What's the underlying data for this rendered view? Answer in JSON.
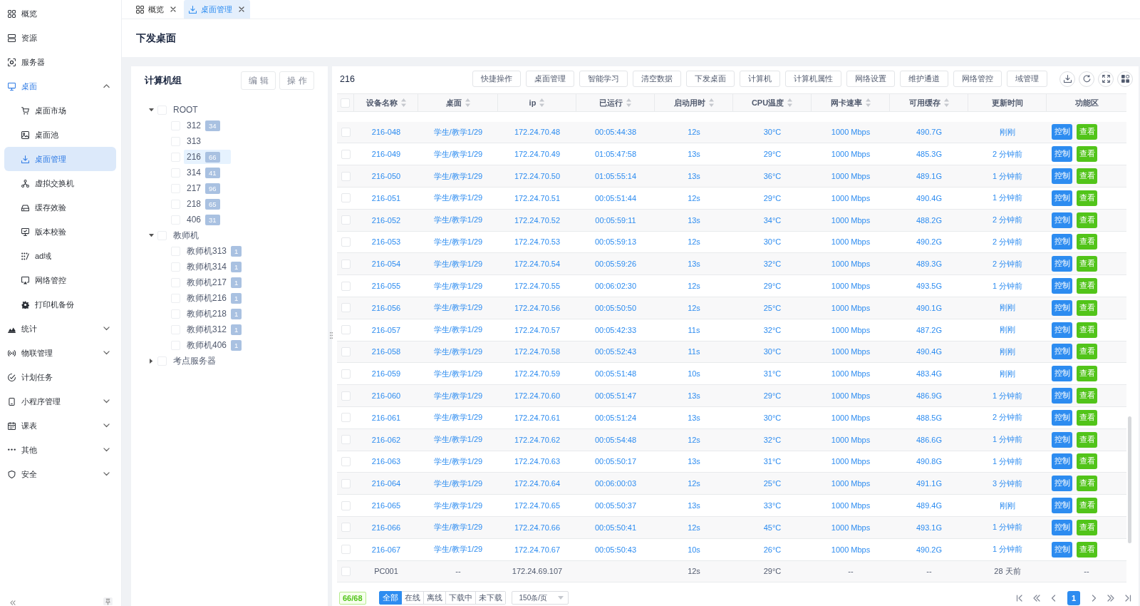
{
  "sidebar": {
    "items": [
      {
        "label": "概览",
        "selected": false
      },
      {
        "label": "资源",
        "selected": false
      },
      {
        "label": "服务器",
        "selected": false
      },
      {
        "label": "桌面",
        "selected": false,
        "expanded": true,
        "children": [
          {
            "label": "桌面市场",
            "selected": false
          },
          {
            "label": "桌面池",
            "selected": false
          },
          {
            "label": "桌面管理",
            "selected": true
          },
          {
            "label": "虚拟交换机",
            "selected": false
          },
          {
            "label": "缓存效验",
            "selected": false
          },
          {
            "label": "版本校验",
            "selected": false
          },
          {
            "label": "ad域",
            "selected": false
          },
          {
            "label": "网络管控",
            "selected": false
          },
          {
            "label": "打印机备份",
            "selected": false
          }
        ]
      },
      {
        "label": "统计",
        "selected": false,
        "expanded": false
      },
      {
        "label": "物联管理",
        "selected": false,
        "expanded": false
      },
      {
        "label": "计划任务",
        "selected": false
      },
      {
        "label": "小程序管理",
        "selected": false,
        "expanded": false
      },
      {
        "label": "课表",
        "selected": false,
        "expanded": false
      },
      {
        "label": "其他",
        "selected": false,
        "expanded": false
      },
      {
        "label": "安全",
        "selected": false,
        "expanded": false
      }
    ]
  },
  "tabs": [
    {
      "label": "概览",
      "selected": false
    },
    {
      "label": "桌面管理",
      "selected": true
    }
  ],
  "page_title": "下发桌面",
  "tree_panel": {
    "title": "计算机组",
    "buttons": [
      "编辑",
      "操作"
    ],
    "nodes": [
      {
        "label": "ROOT",
        "expanded": true,
        "checked": false,
        "selected": false,
        "children": [
          {
            "label": "312",
            "count": "34",
            "checked": false,
            "selected": false
          },
          {
            "label": "313",
            "checked": false,
            "selected": false
          },
          {
            "label": "216",
            "count": "66",
            "checked": false,
            "selected": true
          },
          {
            "label": "314",
            "count": "41",
            "checked": false,
            "selected": false
          },
          {
            "label": "217",
            "count": "96",
            "checked": false,
            "selected": false
          },
          {
            "label": "218",
            "count": "65",
            "checked": false,
            "selected": false
          },
          {
            "label": "406",
            "count": "31",
            "checked": false,
            "selected": false
          }
        ]
      },
      {
        "label": "教师机",
        "expanded": true,
        "checked": false,
        "selected": false,
        "children": [
          {
            "label": "教师机313",
            "count": "1",
            "checked": false,
            "selected": false
          },
          {
            "label": "教师机314",
            "count": "1",
            "checked": false,
            "selected": false
          },
          {
            "label": "教师机217",
            "count": "1",
            "checked": false,
            "selected": false
          },
          {
            "label": "教师机216",
            "count": "1",
            "checked": false,
            "selected": false
          },
          {
            "label": "教师机218",
            "count": "1",
            "checked": false,
            "selected": false
          },
          {
            "label": "教师机312",
            "count": "1",
            "checked": false,
            "selected": false
          },
          {
            "label": "教师机406",
            "count": "1",
            "checked": false,
            "selected": false
          }
        ]
      },
      {
        "label": "考点服务器",
        "expanded": false,
        "checked": false,
        "selected": false
      }
    ]
  },
  "device_panel": {
    "group": "216",
    "toolbar": [
      "快捷操作",
      "桌面管理",
      "智能学习",
      "清空数据",
      "下发桌面",
      "计算机",
      "计算机属性",
      "网络设置",
      "维护通道",
      "网络管控",
      "域管理"
    ],
    "table": {
      "header_checked": false,
      "columns": [
        {
          "label": "设备名称",
          "sortable": true
        },
        {
          "label": "桌面",
          "sortable": true
        },
        {
          "label": "ip",
          "sortable": true
        },
        {
          "label": "已运行",
          "sortable": true
        },
        {
          "label": "启动用时",
          "sortable": true
        },
        {
          "label": "CPU温度",
          "sortable": true
        },
        {
          "label": "网卡速率",
          "sortable": true
        },
        {
          "label": "可用缓存",
          "sortable": true
        },
        {
          "label": "更新时间",
          "sortable": false
        },
        {
          "label": "功能区",
          "sortable": false
        }
      ],
      "rows": [
        {
          "checked": false,
          "online": true,
          "device_name": "216-048",
          "desktop": "学生/教学1/29",
          "ip": "172.24.70.48",
          "uptime": "00:05:44:38",
          "boot_time": "12s",
          "cpu_temp": "30°C",
          "nic_speed": "1000 Mbps",
          "free_cache": "490.7G",
          "updated": "刚刚",
          "actions": [
            "控制",
            "查看"
          ]
        },
        {
          "checked": false,
          "online": true,
          "device_name": "216-049",
          "desktop": "学生/教学1/29",
          "ip": "172.24.70.49",
          "uptime": "01:05:47:58",
          "boot_time": "13s",
          "cpu_temp": "29°C",
          "nic_speed": "1000 Mbps",
          "free_cache": "485.3G",
          "updated": "2 分钟前",
          "actions": [
            "控制",
            "查看"
          ]
        },
        {
          "checked": false,
          "online": true,
          "device_name": "216-050",
          "desktop": "学生/教学1/29",
          "ip": "172.24.70.50",
          "uptime": "01:05:55:14",
          "boot_time": "13s",
          "cpu_temp": "36°C",
          "nic_speed": "1000 Mbps",
          "free_cache": "489.1G",
          "updated": "1 分钟前",
          "actions": [
            "控制",
            "查看"
          ]
        },
        {
          "checked": false,
          "online": true,
          "device_name": "216-051",
          "desktop": "学生/教学1/29",
          "ip": "172.24.70.51",
          "uptime": "00:05:51:44",
          "boot_time": "12s",
          "cpu_temp": "29°C",
          "nic_speed": "1000 Mbps",
          "free_cache": "490.4G",
          "updated": "1 分钟前",
          "actions": [
            "控制",
            "查看"
          ]
        },
        {
          "checked": false,
          "online": true,
          "device_name": "216-052",
          "desktop": "学生/教学1/29",
          "ip": "172.24.70.52",
          "uptime": "00:05:59:11",
          "boot_time": "13s",
          "cpu_temp": "34°C",
          "nic_speed": "1000 Mbps",
          "free_cache": "488.2G",
          "updated": "2 分钟前",
          "actions": [
            "控制",
            "查看"
          ]
        },
        {
          "checked": false,
          "online": true,
          "device_name": "216-053",
          "desktop": "学生/教学1/29",
          "ip": "172.24.70.53",
          "uptime": "00:05:59:13",
          "boot_time": "12s",
          "cpu_temp": "30°C",
          "nic_speed": "1000 Mbps",
          "free_cache": "490.2G",
          "updated": "2 分钟前",
          "actions": [
            "控制",
            "查看"
          ]
        },
        {
          "checked": false,
          "online": true,
          "device_name": "216-054",
          "desktop": "学生/教学1/29",
          "ip": "172.24.70.54",
          "uptime": "00:05:59:26",
          "boot_time": "13s",
          "cpu_temp": "32°C",
          "nic_speed": "1000 Mbps",
          "free_cache": "489.3G",
          "updated": "2 分钟前",
          "actions": [
            "控制",
            "查看"
          ]
        },
        {
          "checked": false,
          "online": true,
          "device_name": "216-055",
          "desktop": "学生/教学1/29",
          "ip": "172.24.70.55",
          "uptime": "00:06:02:30",
          "boot_time": "12s",
          "cpu_temp": "29°C",
          "nic_speed": "1000 Mbps",
          "free_cache": "493.5G",
          "updated": "1 分钟前",
          "actions": [
            "控制",
            "查看"
          ]
        },
        {
          "checked": false,
          "online": true,
          "device_name": "216-056",
          "desktop": "学生/教学1/29",
          "ip": "172.24.70.56",
          "uptime": "00:05:50:50",
          "boot_time": "12s",
          "cpu_temp": "25°C",
          "nic_speed": "1000 Mbps",
          "free_cache": "490.1G",
          "updated": "刚刚",
          "actions": [
            "控制",
            "查看"
          ]
        },
        {
          "checked": false,
          "online": true,
          "device_name": "216-057",
          "desktop": "学生/教学1/29",
          "ip": "172.24.70.57",
          "uptime": "00:05:42:33",
          "boot_time": "11s",
          "cpu_temp": "32°C",
          "nic_speed": "1000 Mbps",
          "free_cache": "487.2G",
          "updated": "刚刚",
          "actions": [
            "控制",
            "查看"
          ]
        },
        {
          "checked": false,
          "online": true,
          "device_name": "216-058",
          "desktop": "学生/教学1/29",
          "ip": "172.24.70.58",
          "uptime": "00:05:52:43",
          "boot_time": "11s",
          "cpu_temp": "30°C",
          "nic_speed": "1000 Mbps",
          "free_cache": "490.4G",
          "updated": "刚刚",
          "actions": [
            "控制",
            "查看"
          ]
        },
        {
          "checked": false,
          "online": true,
          "device_name": "216-059",
          "desktop": "学生/教学1/29",
          "ip": "172.24.70.59",
          "uptime": "00:05:51:48",
          "boot_time": "10s",
          "cpu_temp": "31°C",
          "nic_speed": "1000 Mbps",
          "free_cache": "483.4G",
          "updated": "刚刚",
          "actions": [
            "控制",
            "查看"
          ]
        },
        {
          "checked": false,
          "online": true,
          "device_name": "216-060",
          "desktop": "学生/教学1/29",
          "ip": "172.24.70.60",
          "uptime": "00:05:51:47",
          "boot_time": "13s",
          "cpu_temp": "29°C",
          "nic_speed": "1000 Mbps",
          "free_cache": "486.9G",
          "updated": "1 分钟前",
          "actions": [
            "控制",
            "查看"
          ]
        },
        {
          "checked": false,
          "online": true,
          "device_name": "216-061",
          "desktop": "学生/教学1/29",
          "ip": "172.24.70.61",
          "uptime": "00:05:51:24",
          "boot_time": "13s",
          "cpu_temp": "30°C",
          "nic_speed": "1000 Mbps",
          "free_cache": "488.5G",
          "updated": "2 分钟前",
          "actions": [
            "控制",
            "查看"
          ]
        },
        {
          "checked": false,
          "online": true,
          "device_name": "216-062",
          "desktop": "学生/教学1/29",
          "ip": "172.24.70.62",
          "uptime": "00:05:54:48",
          "boot_time": "12s",
          "cpu_temp": "32°C",
          "nic_speed": "1000 Mbps",
          "free_cache": "486.6G",
          "updated": "1 分钟前",
          "actions": [
            "控制",
            "查看"
          ]
        },
        {
          "checked": false,
          "online": true,
          "device_name": "216-063",
          "desktop": "学生/教学1/29",
          "ip": "172.24.70.63",
          "uptime": "00:05:50:17",
          "boot_time": "13s",
          "cpu_temp": "31°C",
          "nic_speed": "1000 Mbps",
          "free_cache": "490.8G",
          "updated": "1 分钟前",
          "actions": [
            "控制",
            "查看"
          ]
        },
        {
          "checked": false,
          "online": true,
          "device_name": "216-064",
          "desktop": "学生/教学1/29",
          "ip": "172.24.70.64",
          "uptime": "00:06:00:03",
          "boot_time": "12s",
          "cpu_temp": "25°C",
          "nic_speed": "1000 Mbps",
          "free_cache": "491.1G",
          "updated": "3 分钟前",
          "actions": [
            "控制",
            "查看"
          ]
        },
        {
          "checked": false,
          "online": true,
          "device_name": "216-065",
          "desktop": "学生/教学1/29",
          "ip": "172.24.70.65",
          "uptime": "00:05:50:37",
          "boot_time": "13s",
          "cpu_temp": "33°C",
          "nic_speed": "1000 Mbps",
          "free_cache": "489.4G",
          "updated": "刚刚",
          "actions": [
            "控制",
            "查看"
          ]
        },
        {
          "checked": false,
          "online": true,
          "device_name": "216-066",
          "desktop": "学生/教学1/29",
          "ip": "172.24.70.66",
          "uptime": "00:05:50:41",
          "boot_time": "12s",
          "cpu_temp": "45°C",
          "nic_speed": "1000 Mbps",
          "free_cache": "493.1G",
          "updated": "1 分钟前",
          "actions": [
            "控制",
            "查看"
          ]
        },
        {
          "checked": false,
          "online": true,
          "device_name": "216-067",
          "desktop": "学生/教学1/29",
          "ip": "172.24.70.67",
          "uptime": "00:05:50:43",
          "boot_time": "10s",
          "cpu_temp": "26°C",
          "nic_speed": "1000 Mbps",
          "free_cache": "490.2G",
          "updated": "1 分钟前",
          "actions": [
            "控制",
            "查看"
          ]
        },
        {
          "checked": false,
          "online": false,
          "device_name": "PC001",
          "desktop": "--",
          "ip": "172.24.69.107",
          "boot_time": "12s",
          "cpu_temp": "29°C",
          "nic_speed": "--",
          "free_cache": "--",
          "updated": "28 天前",
          "function": "--"
        }
      ]
    },
    "footer": {
      "count": "66/68",
      "filters": [
        {
          "label": "全部",
          "selected": true
        },
        {
          "label": "在线",
          "selected": false
        },
        {
          "label": "离线",
          "selected": false
        },
        {
          "label": "下载中",
          "selected": false
        },
        {
          "label": "未下载",
          "selected": false
        }
      ],
      "page_size": "150条/页",
      "pages": [
        {
          "label": "1",
          "selected": true
        }
      ]
    }
  }
}
